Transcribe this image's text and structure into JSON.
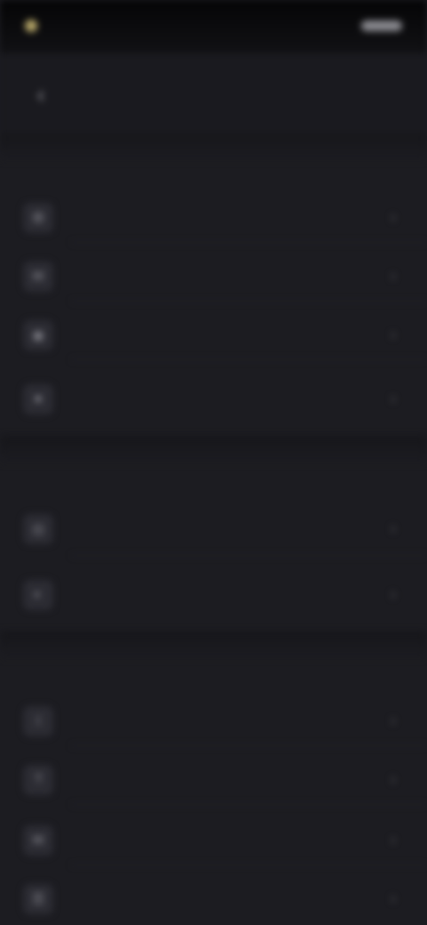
{
  "status_bar": {
    "time": "",
    "carrier": "",
    "battery_icon": "battery-icon"
  },
  "nav": {
    "title": "",
    "back_icon": "chevron-left-icon"
  },
  "sections": [
    {
      "header": "",
      "items": [
        {
          "label": "",
          "icon": "gear-icon"
        },
        {
          "label": "",
          "icon": "bell-icon"
        },
        {
          "label": "",
          "icon": "lock-icon"
        },
        {
          "label": "",
          "icon": "user-icon"
        }
      ]
    },
    {
      "header": "",
      "items": [
        {
          "label": "",
          "icon": "globe-icon"
        },
        {
          "label": "",
          "icon": "palette-icon"
        }
      ]
    },
    {
      "header": "",
      "items": [
        {
          "label": "",
          "icon": "info-icon"
        },
        {
          "label": "",
          "icon": "help-icon"
        },
        {
          "label": "",
          "icon": "mail-icon"
        },
        {
          "label": "",
          "icon": "document-icon"
        }
      ]
    }
  ],
  "colors": {
    "background": "#1c1c21",
    "status_bar": "#08080a",
    "accent": "#b9a96a",
    "text": "#c9c9cf",
    "chevron": "#55555c"
  }
}
